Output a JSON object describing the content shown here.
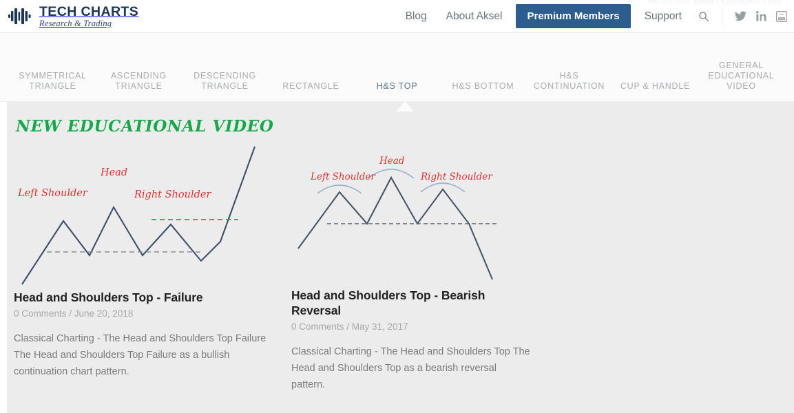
{
  "header": {
    "breadcrumb": {
      "prefix": "You are here:",
      "home": "Home",
      "separator": "/",
      "current": "Educational Video"
    },
    "logo": {
      "icon": "bar-chart-logo-icon",
      "title": "TECH CHARTS",
      "subtitle": "Research & Trading"
    },
    "nav": [
      {
        "label": "Blog",
        "style": "plain"
      },
      {
        "label": "About Aksel",
        "style": "plain"
      },
      {
        "label": "Premium Members",
        "style": "primary"
      },
      {
        "label": "Support",
        "style": "plain"
      }
    ],
    "search_icon": "search-icon",
    "social": [
      {
        "name": "twitter-icon",
        "label": "Twitter"
      },
      {
        "name": "linkedin-icon",
        "label": "LinkedIn"
      },
      {
        "name": "youtube-icon",
        "label": "YouTube"
      }
    ],
    "colors": {
      "premium_bg": "#2d5d8e",
      "logo_navy": "#1d3557",
      "nav_text": "#6f7478"
    }
  },
  "subnav": {
    "items": [
      {
        "label": "SYMMETRICAL TRIANGLE",
        "active": false
      },
      {
        "label": "ASCENDING TRIANGLE",
        "active": false
      },
      {
        "label": "DESCENDING TRIANGLE",
        "active": false
      },
      {
        "label": "RECTANGLE",
        "active": false
      },
      {
        "label": "H&S TOP",
        "active": true
      },
      {
        "label": "H&S BOTTOM",
        "active": false
      },
      {
        "label": "H&S CONTINUATION",
        "active": false
      },
      {
        "label": "CUP & HANDLE",
        "active": false
      },
      {
        "label": "GENERAL EDUCATIONAL VIDEO",
        "active": false
      }
    ],
    "active_color": "#5a7292",
    "inactive_color": "#a9abad"
  },
  "main": {
    "banner": "NEW EDUCATIONAL VIDEO",
    "banner_color": "#18a84b",
    "cards": [
      {
        "title": "Head and Shoulders Top - Failure",
        "comments": "0 Comments",
        "date": "June 20, 2018",
        "meta": "0 Comments / June 20, 2018",
        "excerpt": "Classical Charting - The Head and Shoulders Top Failure The Head and Shoulders Top Failure as a bullish continuation chart pattern.",
        "figure": {
          "name": "head-and-shoulders-failure-diagram",
          "labels": [
            "Left Shoulder",
            "Head",
            "Right Shoulder"
          ],
          "label_color": "#e03131",
          "line_color": "#3d4f6b",
          "neckline_color": "#7b7b7b",
          "breakout_line_color": "#18a84b"
        }
      },
      {
        "title": "Head and Shoulders Top - Bearish Reversal",
        "comments": "0 Comments",
        "date": "May 31, 2017",
        "meta": "0 Comments / May 31, 2017",
        "excerpt": "Classical Charting - The Head and Shoulders Top The Head and Shoulders Top as a bearish reversal pattern.",
        "figure": {
          "name": "head-and-shoulders-bearish-reversal-diagram",
          "labels": [
            "Left Shoulder",
            "Head",
            "Right Shoulder"
          ],
          "label_color": "#e03131",
          "line_color": "#4a5568",
          "neckline_color": "#5c6470",
          "arc_color": "#9fb4cc"
        }
      }
    ]
  }
}
